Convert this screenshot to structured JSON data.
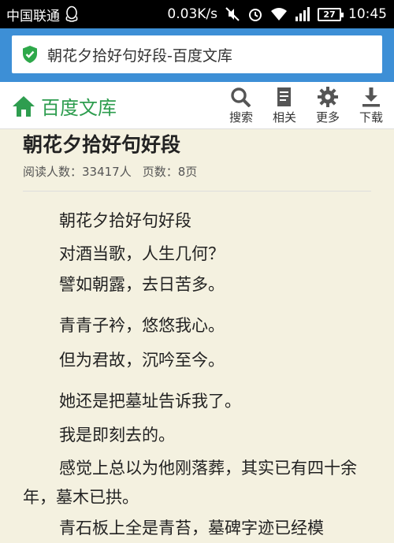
{
  "status_bar": {
    "carrier": "中国联通",
    "speed": "0.03K/s",
    "battery": "27",
    "time": "10:45"
  },
  "url_bar": {
    "page_title": "朝花夕拾好句好段-百度文库"
  },
  "site_header": {
    "site_name": "百度文库",
    "tools": [
      {
        "label": "搜索",
        "icon": "search-icon"
      },
      {
        "label": "相关",
        "icon": "document-icon"
      },
      {
        "label": "更多",
        "icon": "gear-icon"
      },
      {
        "label": "下载",
        "icon": "download-icon"
      }
    ]
  },
  "article": {
    "title": "朝花夕拾好句好段",
    "readers": "阅读人数：33417人",
    "pages": "页数：8页",
    "paragraphs": [
      "朝花夕拾好句好段",
      "对酒当歌，人生几何？",
      "譬如朝露，去日苦多。",
      "青青子衿，悠悠我心。",
      "但为君故，沉吟至今。",
      "她还是把墓址告诉我了。",
      "我是即刻去的。",
      "感觉上总以为他刚落葬，其实已有四十余年，墓木已拱。",
      "青石板上全是青苔，墓碑字迹已经模"
    ]
  },
  "colors": {
    "status_bg": "#000000",
    "url_bar_bg": "#3d8fd6",
    "brand_green": "#2e9d4f",
    "page_bg": "#f4f1e0"
  }
}
